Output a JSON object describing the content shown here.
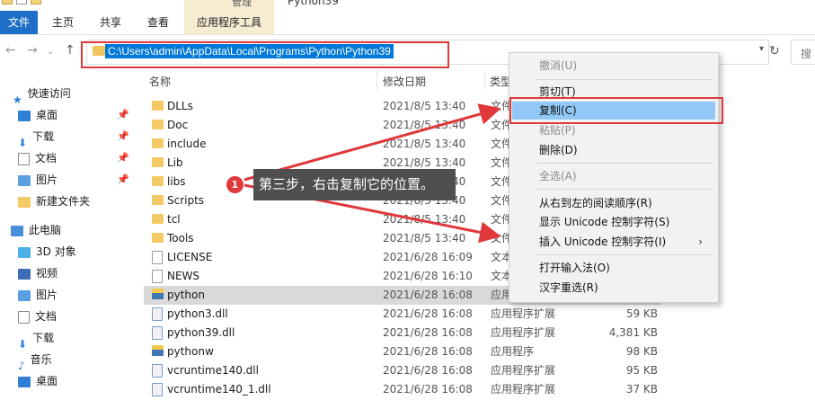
{
  "window": {
    "title": "Python39",
    "context_tab_group": "管理"
  },
  "ribbon": {
    "file_tab": "文件",
    "tabs": [
      "主页",
      "共享",
      "查看"
    ],
    "app_tools_tab": "应用程序工具"
  },
  "address_bar": {
    "path": "C:\\Users\\admin\\AppData\\Local\\Programs\\Python\\Python39",
    "search_placeholder": "搜"
  },
  "nav_pane": {
    "quick_access": "快速访问",
    "quick_items": [
      "桌面",
      "下载",
      "文档",
      "图片",
      "新建文件夹"
    ],
    "this_pc": "此电脑",
    "pc_items": [
      "3D 对象",
      "视频",
      "图片",
      "文档",
      "下载",
      "音乐",
      "桌面"
    ]
  },
  "columns": {
    "name": "名称",
    "date": "修改日期",
    "type": "类型"
  },
  "files": [
    {
      "name": "DLLs",
      "date": "2021/8/5 13:40",
      "type": "文件",
      "size": "",
      "icon": "folder"
    },
    {
      "name": "Doc",
      "date": "2021/8/5 13:40",
      "type": "文件",
      "size": "",
      "icon": "folder"
    },
    {
      "name": "include",
      "date": "2021/8/5 13:40",
      "type": "文件",
      "size": "",
      "icon": "folder"
    },
    {
      "name": "Lib",
      "date": "2021/8/5 13:40",
      "type": "文件",
      "size": "",
      "icon": "folder"
    },
    {
      "name": "libs",
      "date": "2021/8/5 13:40",
      "type": "文件",
      "size": "",
      "icon": "folder"
    },
    {
      "name": "Scripts",
      "date": "2021/8/5 13:40",
      "type": "文件",
      "size": "",
      "icon": "folder"
    },
    {
      "name": "tcl",
      "date": "2021/8/5 13:40",
      "type": "文件",
      "size": "",
      "icon": "folder"
    },
    {
      "name": "Tools",
      "date": "2021/8/5 13:40",
      "type": "文件",
      "size": "",
      "icon": "folder"
    },
    {
      "name": "LICENSE",
      "date": "2021/6/28 16:09",
      "type": "文本",
      "size": "",
      "icon": "doc"
    },
    {
      "name": "NEWS",
      "date": "2021/6/28 16:10",
      "type": "文本",
      "size": "",
      "icon": "doc"
    },
    {
      "name": "python",
      "date": "2021/6/28 16:08",
      "type": "应用",
      "size": "",
      "icon": "py",
      "selected": true
    },
    {
      "name": "python3.dll",
      "date": "2021/6/28 16:08",
      "type": "应用程序扩展",
      "size": "59 KB",
      "icon": "dll"
    },
    {
      "name": "python39.dll",
      "date": "2021/6/28 16:08",
      "type": "应用程序扩展",
      "size": "4,381 KB",
      "icon": "dll"
    },
    {
      "name": "pythonw",
      "date": "2021/6/28 16:08",
      "type": "应用程序",
      "size": "98 KB",
      "icon": "pyw"
    },
    {
      "name": "vcruntime140.dll",
      "date": "2021/6/28 16:08",
      "type": "应用程序扩展",
      "size": "95 KB",
      "icon": "dll"
    },
    {
      "name": "vcruntime140_1.dll",
      "date": "2021/6/28 16:08",
      "type": "应用程序扩展",
      "size": "37 KB",
      "icon": "dll"
    }
  ],
  "context_menu": {
    "undo": "撤消(U)",
    "cut": "剪切(T)",
    "copy": "复制(C)",
    "paste": "粘贴(P)",
    "delete": "删除(D)",
    "select_all": "全选(A)",
    "rtl": "从右到左的阅读顺序(R)",
    "show_unicode": "显示 Unicode 控制字符(S)",
    "insert_unicode": "插入 Unicode 控制字符(I)",
    "open_ime": "打开输入法(O)",
    "reconversion": "汉字重选(R)"
  },
  "annotation": {
    "step_number": "1",
    "text": "第三步，右击复制它的位置。"
  },
  "colors": {
    "accent": "#0078d7",
    "annotation_red": "#e0383b",
    "menu_highlight": "#91c8f6"
  }
}
